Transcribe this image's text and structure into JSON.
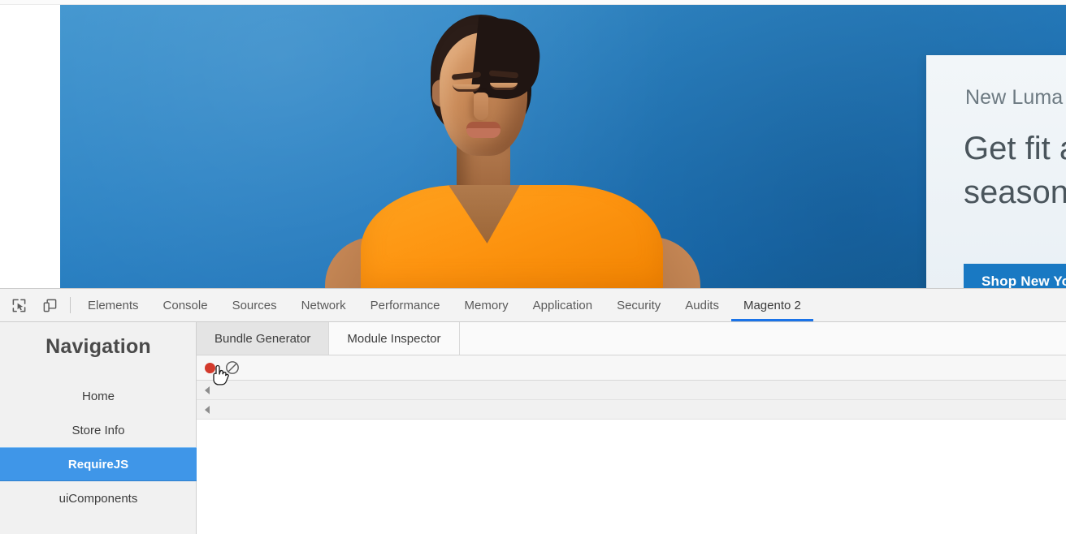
{
  "page": {
    "hero": {
      "eyebrow": "New Luma Yoga Collection",
      "headline_line1": "Get fit and look fab in",
      "headline_line2": "seasonal styles",
      "cta_label": "Shop New Yoga"
    }
  },
  "devtools": {
    "icons": {
      "inspect": "inspect-element-icon",
      "device": "device-toolbar-icon"
    },
    "tabs": [
      {
        "label": "Elements",
        "active": false
      },
      {
        "label": "Console",
        "active": false
      },
      {
        "label": "Sources",
        "active": false
      },
      {
        "label": "Network",
        "active": false
      },
      {
        "label": "Performance",
        "active": false
      },
      {
        "label": "Memory",
        "active": false
      },
      {
        "label": "Application",
        "active": false
      },
      {
        "label": "Security",
        "active": false
      },
      {
        "label": "Audits",
        "active": false
      },
      {
        "label": "Magento 2",
        "active": true
      }
    ],
    "accent_color": "#1a73e8",
    "sidebar": {
      "title": "Navigation",
      "items": [
        {
          "label": "Home",
          "active": false
        },
        {
          "label": "Store Info",
          "active": false
        },
        {
          "label": "RequireJS",
          "active": true
        },
        {
          "label": "uiComponents",
          "active": false
        }
      ],
      "selected_color": "#3f96e8"
    },
    "panel": {
      "sub_tabs": [
        {
          "label": "Bundle Generator",
          "active": true
        },
        {
          "label": "Module Inspector",
          "active": false
        }
      ],
      "toolbar": {
        "record_name": "record-button",
        "record_color": "#d33a2c",
        "clear_name": "clear-button"
      },
      "tree_rows": [
        {
          "expanded": false
        },
        {
          "expanded": false
        }
      ]
    }
  }
}
